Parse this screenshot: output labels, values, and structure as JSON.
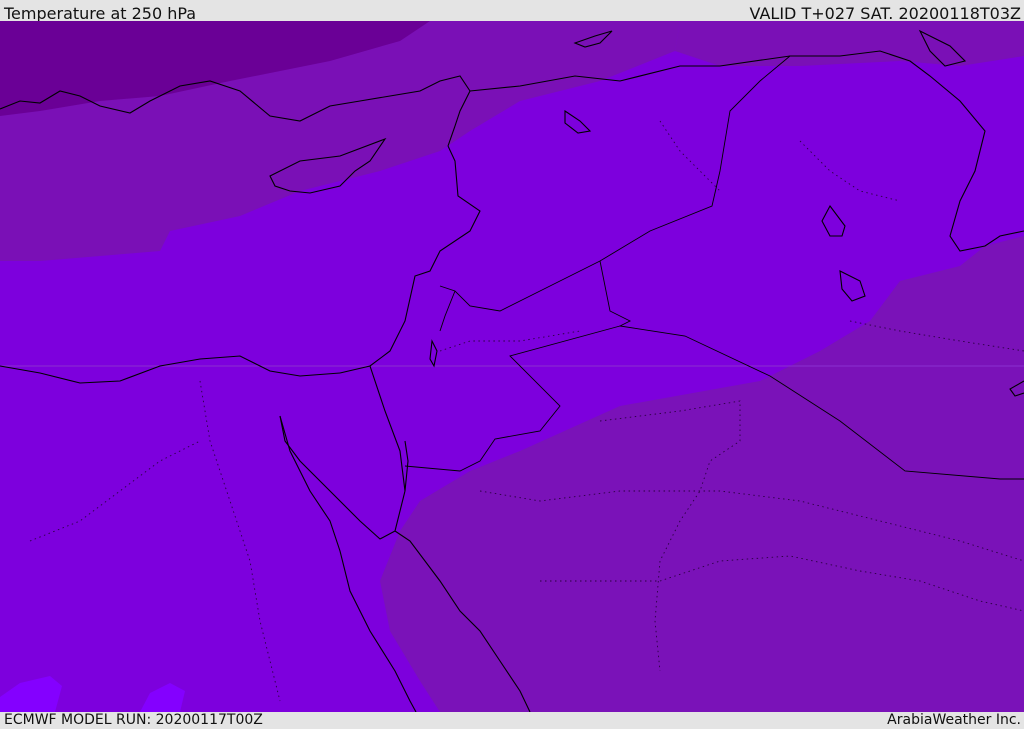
{
  "header": {
    "title": "Temperature at 250 hPa",
    "valid": "VALID T+027 SAT. 20200118T03Z"
  },
  "footer": {
    "model_run": "ECMWF MODEL RUN: 20200117T00Z",
    "credit": "ArabiaWeather Inc."
  },
  "map": {
    "variable": "Temperature",
    "level_hpa": 250,
    "fill_colors": {
      "coldest": "#6a0096",
      "cold": "#7a10b6",
      "mid": "#7d00dd",
      "warm": "#8400ff",
      "south_patch": "#7a12b8"
    },
    "line_color": "#000000"
  }
}
